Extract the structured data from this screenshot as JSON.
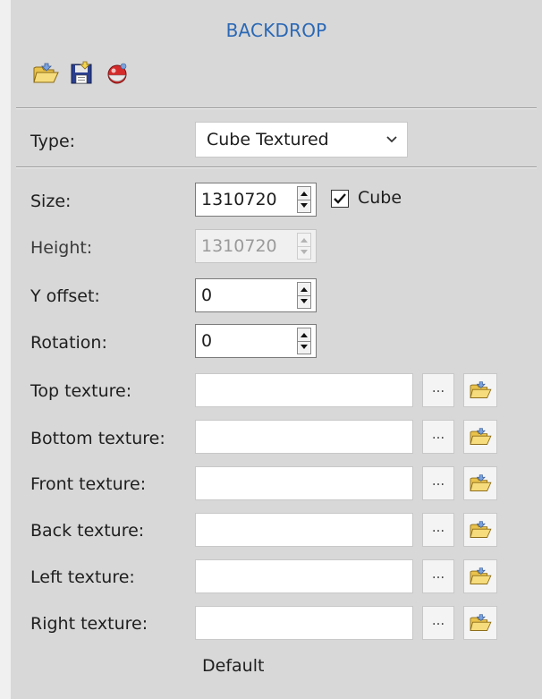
{
  "panel": {
    "title": "BACKDROP"
  },
  "toolbar": {
    "icons": [
      "folder-open-icon",
      "save-icon",
      "color-sphere-icon"
    ]
  },
  "type": {
    "label": "Type:",
    "value": "Cube Textured"
  },
  "size": {
    "label": "Size:",
    "value": "1310720"
  },
  "cube": {
    "label": "Cube",
    "checked": true
  },
  "height": {
    "label": "Height:",
    "value": "1310720",
    "disabled": true
  },
  "yoffset": {
    "label": "Y offset:",
    "value": "0"
  },
  "rotation": {
    "label": "Rotation:",
    "value": "0"
  },
  "textures": [
    {
      "label": "Top texture:",
      "value": "",
      "browse": "..."
    },
    {
      "label": "Bottom texture:",
      "value": "",
      "browse": "..."
    },
    {
      "label": "Front texture:",
      "value": "",
      "browse": "..."
    },
    {
      "label": "Back texture:",
      "value": "",
      "browse": "..."
    },
    {
      "label": "Left texture:",
      "value": "",
      "browse": "..."
    },
    {
      "label": "Right texture:",
      "value": "",
      "browse": "..."
    }
  ],
  "footer": {
    "label": "Default"
  },
  "colors": {
    "title": "#2b68b5",
    "panel": "#d8d8d8",
    "background": "#f0f0f0"
  }
}
